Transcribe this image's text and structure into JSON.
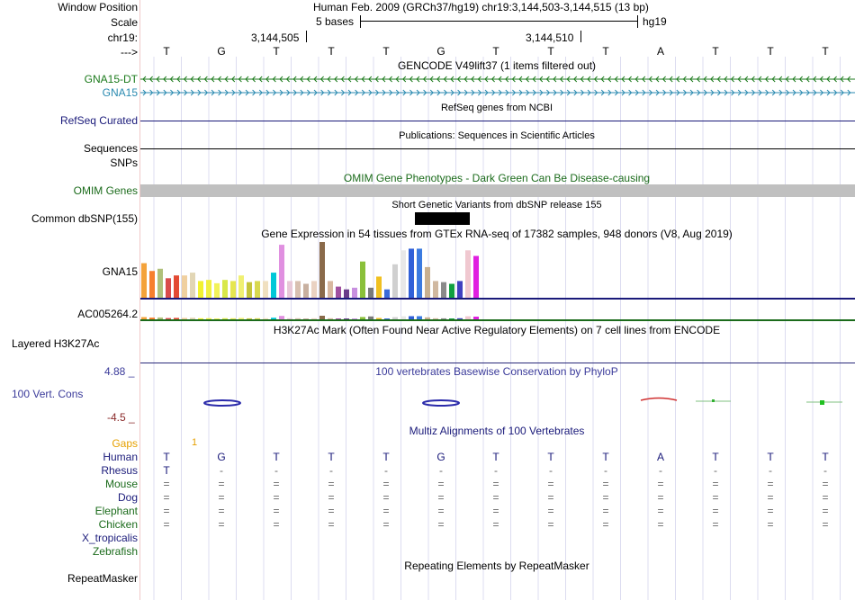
{
  "header": {
    "window_position_label": "Window Position",
    "window_position_text": "Human Feb. 2009 (GRCh37/hg19)    chr19:3,144,503-3,144,515 (13 bp)",
    "scale_label": "Scale",
    "scale_text": "5 bases",
    "scale_db": "hg19",
    "chrom_label": "chr19:",
    "pos1": "3,144,505",
    "pos2": "3,144,510",
    "strand_label": "--->"
  },
  "sequence": [
    "T",
    "G",
    "T",
    "T",
    "T",
    "G",
    "T",
    "T",
    "T",
    "A",
    "T",
    "T",
    "T"
  ],
  "tracks": {
    "gencode": {
      "title": "GENCODE V49lift37 (1 items filtered out)",
      "item1": "GNA15-DT",
      "item2": "GNA15",
      "color1": "#1b7a1b",
      "color2": "#2a8ab0"
    },
    "refseq": {
      "title": "RefSeq genes from NCBI",
      "label": "RefSeq Curated",
      "color": "#1a1a7a"
    },
    "pubs": {
      "title": "Publications: Sequences in Scientific Articles",
      "label": "Sequences"
    },
    "snps": {
      "label": "SNPs"
    },
    "omim": {
      "title": "OMIM Gene Phenotypes - Dark Green Can Be Disease-causing",
      "label": "OMIM Genes",
      "color": "#1b6b1b"
    },
    "dbsnp": {
      "title": "Short Genetic Variants from dbSNP release 155",
      "label": "Common dbSNP(155)"
    },
    "gtex": {
      "title": "Gene Expression in 54 tissues from GTEx RNA-seq of 17382 samples, 948 donors (V8, Aug 2019)",
      "label1": "GNA15",
      "label2": "AC005264.2"
    },
    "h3k27ac": {
      "title": "H3K27Ac Mark (Often Found Near Active Regulatory Elements) on 7 cell lines from ENCODE",
      "label": "Layered H3K27Ac"
    },
    "phylop": {
      "title": "100 vertebrates Basewise Conservation by PhyloP",
      "label": "100 Vert. Cons",
      "max": "4.88 _",
      "min": "-4.5 _",
      "color": "#3a3a9a"
    },
    "multiz": {
      "title": "Multiz Alignments of 100 Vertebrates",
      "gaps_label": "Gaps",
      "gaps_value": "1",
      "gaps_color": "#e6a000"
    },
    "repeat": {
      "title": "Repeating Elements by RepeatMasker",
      "label": "RepeatMasker"
    }
  },
  "species": [
    {
      "name": "Human",
      "color": "#1a1a7a",
      "row": [
        "T",
        "G",
        "T",
        "T",
        "T",
        "G",
        "T",
        "T",
        "T",
        "A",
        "T",
        "T",
        "T"
      ]
    },
    {
      "name": "Rhesus",
      "color": "#1a1a7a",
      "row": [
        "T",
        "-",
        "-",
        "-",
        "-",
        "-",
        "-",
        "-",
        "-",
        "-",
        "-",
        "-",
        "-"
      ]
    },
    {
      "name": "Mouse",
      "color": "#1b6b1b",
      "row": [
        "=",
        "=",
        "=",
        "=",
        "=",
        "=",
        "=",
        "=",
        "=",
        "=",
        "=",
        "=",
        "="
      ]
    },
    {
      "name": "Dog",
      "color": "#1a1a7a",
      "row": [
        "=",
        "=",
        "=",
        "=",
        "=",
        "=",
        "=",
        "=",
        "=",
        "=",
        "=",
        "=",
        "="
      ]
    },
    {
      "name": "Elephant",
      "color": "#1b6b1b",
      "row": [
        "=",
        "=",
        "=",
        "=",
        "=",
        "=",
        "=",
        "=",
        "=",
        "=",
        "=",
        "=",
        "="
      ]
    },
    {
      "name": "Chicken",
      "color": "#1b6b1b",
      "row": [
        "=",
        "=",
        "=",
        "=",
        "=",
        "=",
        "=",
        "=",
        "=",
        "=",
        "=",
        "=",
        "="
      ]
    },
    {
      "name": "X_tropicalis",
      "color": "#1a1a7a",
      "row": []
    },
    {
      "name": "Zebrafish",
      "color": "#1b6b1b",
      "row": []
    }
  ],
  "gtex_bar_colors": [
    "#f4a23a",
    "#f77f2e",
    "#b0c07a",
    "#d94b4b",
    "#e34a33",
    "#f0d0a0",
    "#e2d6b5",
    "#f2f230",
    "#f0f040",
    "#f2f25a",
    "#d8e84a",
    "#e6e650",
    "#f0f072",
    "#c4c43a",
    "#d8d84e",
    "#f0e0c0",
    "#00c8d8",
    "#e090e0",
    "#e8c8d8",
    "#d8c0b0",
    "#c8b0a0",
    "#ead2c2",
    "#8a6a4a",
    "#d8b8a0",
    "#a050a0",
    "#6a3c8a",
    "#c890e0",
    "#8ac03a",
    "#7a7a7a",
    "#f0c020",
    "#3a6ad8",
    "#d0d0d0",
    "#e8e8e8",
    "#3060d8",
    "#3a7ae0",
    "#c8b090",
    "#d0b8a0",
    "#8a8a8a",
    "#10a040",
    "#4040c0",
    "#f0c8d0",
    "#e020e0"
  ],
  "gtex_bar_values": [
    0.62,
    0.48,
    0.52,
    0.35,
    0.4,
    0.4,
    0.45,
    0.3,
    0.32,
    0.26,
    0.32,
    0.3,
    0.4,
    0.28,
    0.3,
    0.3,
    0.45,
    0.95,
    0.3,
    0.3,
    0.25,
    0.3,
    1.0,
    0.3,
    0.2,
    0.15,
    0.18,
    0.65,
    0.18,
    0.38,
    0.15,
    0.6,
    0.85,
    0.88,
    0.88,
    0.55,
    0.3,
    0.28,
    0.25,
    0.3,
    0.85,
    0.75
  ]
}
